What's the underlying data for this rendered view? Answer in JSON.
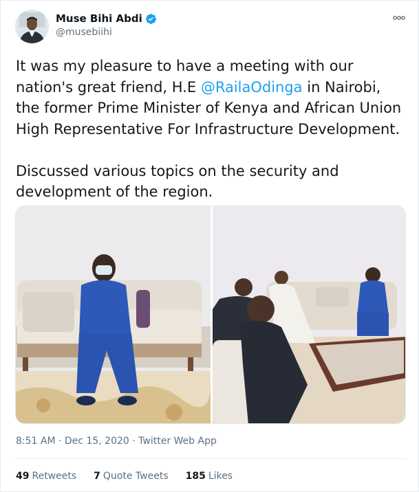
{
  "author": {
    "display_name": "Muse Bihi Abdi",
    "handle": "@musebiihi",
    "verified": true
  },
  "tweet": {
    "text_before_mention": "It was my pleasure to have a meeting with our nation's great friend, H.E ",
    "mention": "@RailaOdinga",
    "text_after_mention": " in Nairobi, the former Prime Minister of Kenya and African Union High Representative For Infrastructure Development.\n\nDiscussed various topics on the security and development of the region."
  },
  "meta": {
    "time": "8:51 AM",
    "separator": "·",
    "date": "Dec 15, 2020",
    "source": "Twitter Web App"
  },
  "stats": {
    "retweets_count": "49",
    "retweets_label": "Retweets",
    "quotes_count": "7",
    "quotes_label": "Quote Tweets",
    "likes_count": "185",
    "likes_label": "Likes"
  },
  "icons": {
    "verified": "verified-badge-icon",
    "more": "more-options-icon"
  },
  "colors": {
    "accent": "#1da1f2",
    "secondary_text": "#5b7083",
    "primary_text": "#14171a"
  }
}
